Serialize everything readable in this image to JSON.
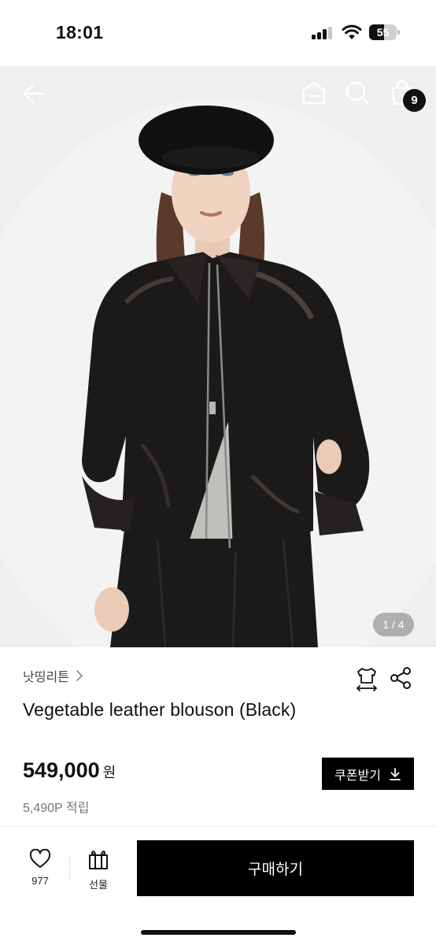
{
  "status_bar": {
    "time": "18:01",
    "battery": "55"
  },
  "nav": {
    "cart_count": "9"
  },
  "gallery": {
    "pager": "1 / 4"
  },
  "product": {
    "brand": "낫띵리튼",
    "title": "Vegetable leather blouson (Black)",
    "price": "549,000",
    "currency": "원",
    "points": "5,490P 적립"
  },
  "actions": {
    "coupon_label": "쿠폰받기",
    "like_count": "977",
    "gift_label": "선물",
    "buy_label": "구매하기"
  },
  "icons": [
    "back-arrow-icon",
    "home-icon",
    "search-icon",
    "shopping-bag-icon",
    "chevron-right-icon",
    "size-guide-icon",
    "share-icon",
    "download-icon",
    "heart-icon",
    "gift-icon"
  ]
}
